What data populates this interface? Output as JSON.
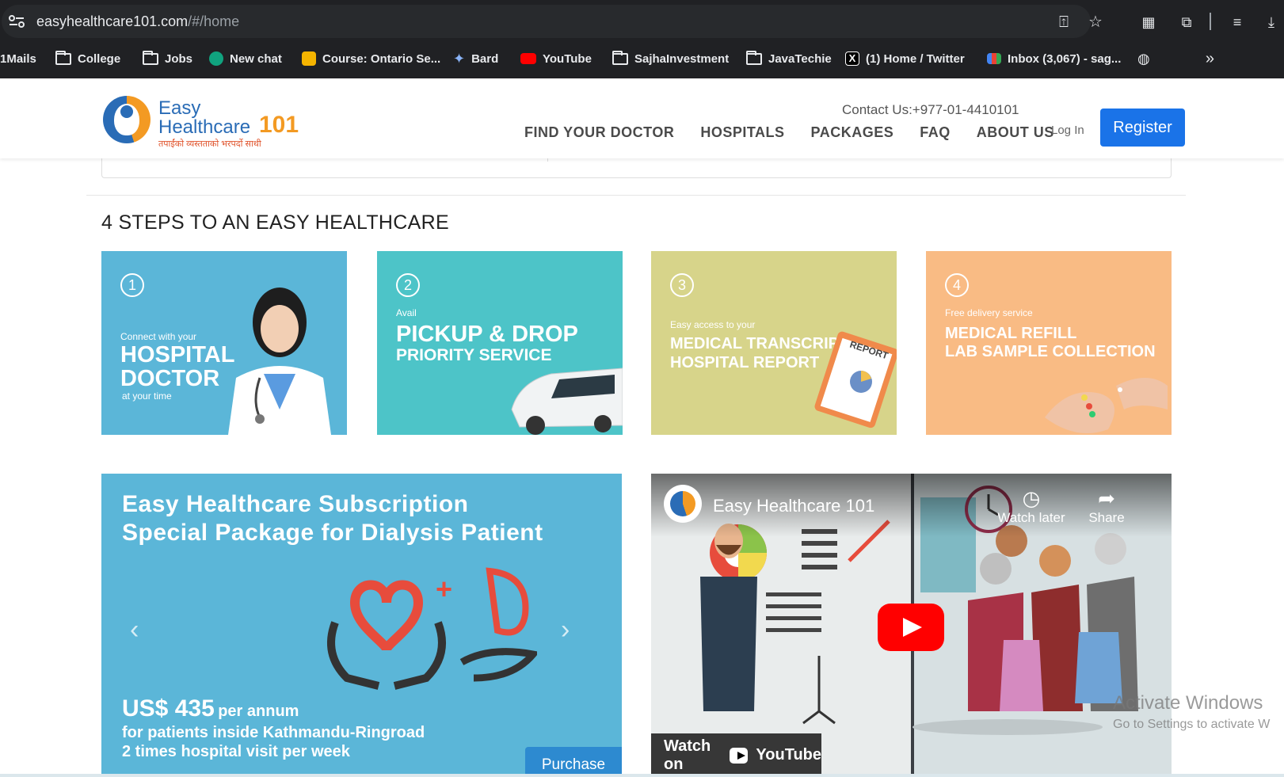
{
  "browser": {
    "url_host": "easyhealthcare101.com",
    "url_path": "/#/home",
    "bookmarks": [
      {
        "label": "1Mails",
        "icon": "none"
      },
      {
        "label": "College",
        "icon": "folder-icon"
      },
      {
        "label": "Jobs",
        "icon": "folder-icon"
      },
      {
        "label": "New chat",
        "icon": "chatgpt-icon"
      },
      {
        "label": "Course: Ontario Se...",
        "icon": "course-icon"
      },
      {
        "label": "Bard",
        "icon": "bard-icon"
      },
      {
        "label": "YouTube",
        "icon": "youtube-icon"
      },
      {
        "label": "SajhaInvestment",
        "icon": "folder-icon"
      },
      {
        "label": "JavaTechie",
        "icon": "folder-icon"
      },
      {
        "label": "(1) Home / Twitter",
        "icon": "x-icon"
      },
      {
        "label": "Inbox (3,067) - sag...",
        "icon": "gmail-icon"
      }
    ],
    "overflow": "»"
  },
  "site": {
    "logo": {
      "easy": "Easy",
      "healthcare": "Healthcare",
      "number": "101",
      "tagline": "तपाईंको व्यस्तताको भरपर्दो साथी"
    },
    "contact": "Contact Us:+977-01-4410101",
    "nav": [
      "FIND YOUR DOCTOR",
      "HOSPITALS",
      "PACKAGES",
      "FAQ",
      "ABOUT US"
    ],
    "login": "Log In",
    "register": "Register"
  },
  "steps": {
    "title": "4 STEPS TO AN EASY HEALTHCARE",
    "cards": [
      {
        "num": "1",
        "small": "Connect with your",
        "line1": "HOSPITAL",
        "line2": "DOCTOR",
        "small2": "at your time",
        "color": "#5bb6d8"
      },
      {
        "num": "2",
        "small": "Avail",
        "line1": "PICKUP & DROP",
        "line2": "PRIORITY SERVICE",
        "color": "#4dc4c8"
      },
      {
        "num": "3",
        "small": "Easy access to your",
        "line1": "MEDICAL TRANSCRIPT",
        "line2": "HOSPITAL REPORT",
        "badge": "REPORT",
        "color": "#d7d48a"
      },
      {
        "num": "4",
        "small": "Free delivery service",
        "line1": "MEDICAL REFILL",
        "line2": "LAB SAMPLE COLLECTION",
        "color": "#f9bb84"
      }
    ]
  },
  "banner": {
    "title1": "Easy Healthcare Subscription",
    "title2": "Special Package for Dialysis Patient",
    "price": "US$ 435",
    "per": "per annum",
    "line1": "for patients inside Kathmandu-Ringroad",
    "line2": "2 times hospital visit per week",
    "purchase": "Purchase",
    "prev": "‹",
    "next": "›"
  },
  "video": {
    "title": "Easy Healthcare 101",
    "watch_later": "Watch later",
    "share": "Share",
    "watch_on": "Watch on",
    "youtube": "YouTube"
  },
  "os_watermark": {
    "line1": "Activate Windows",
    "line2": "Go to Settings to activate W"
  }
}
